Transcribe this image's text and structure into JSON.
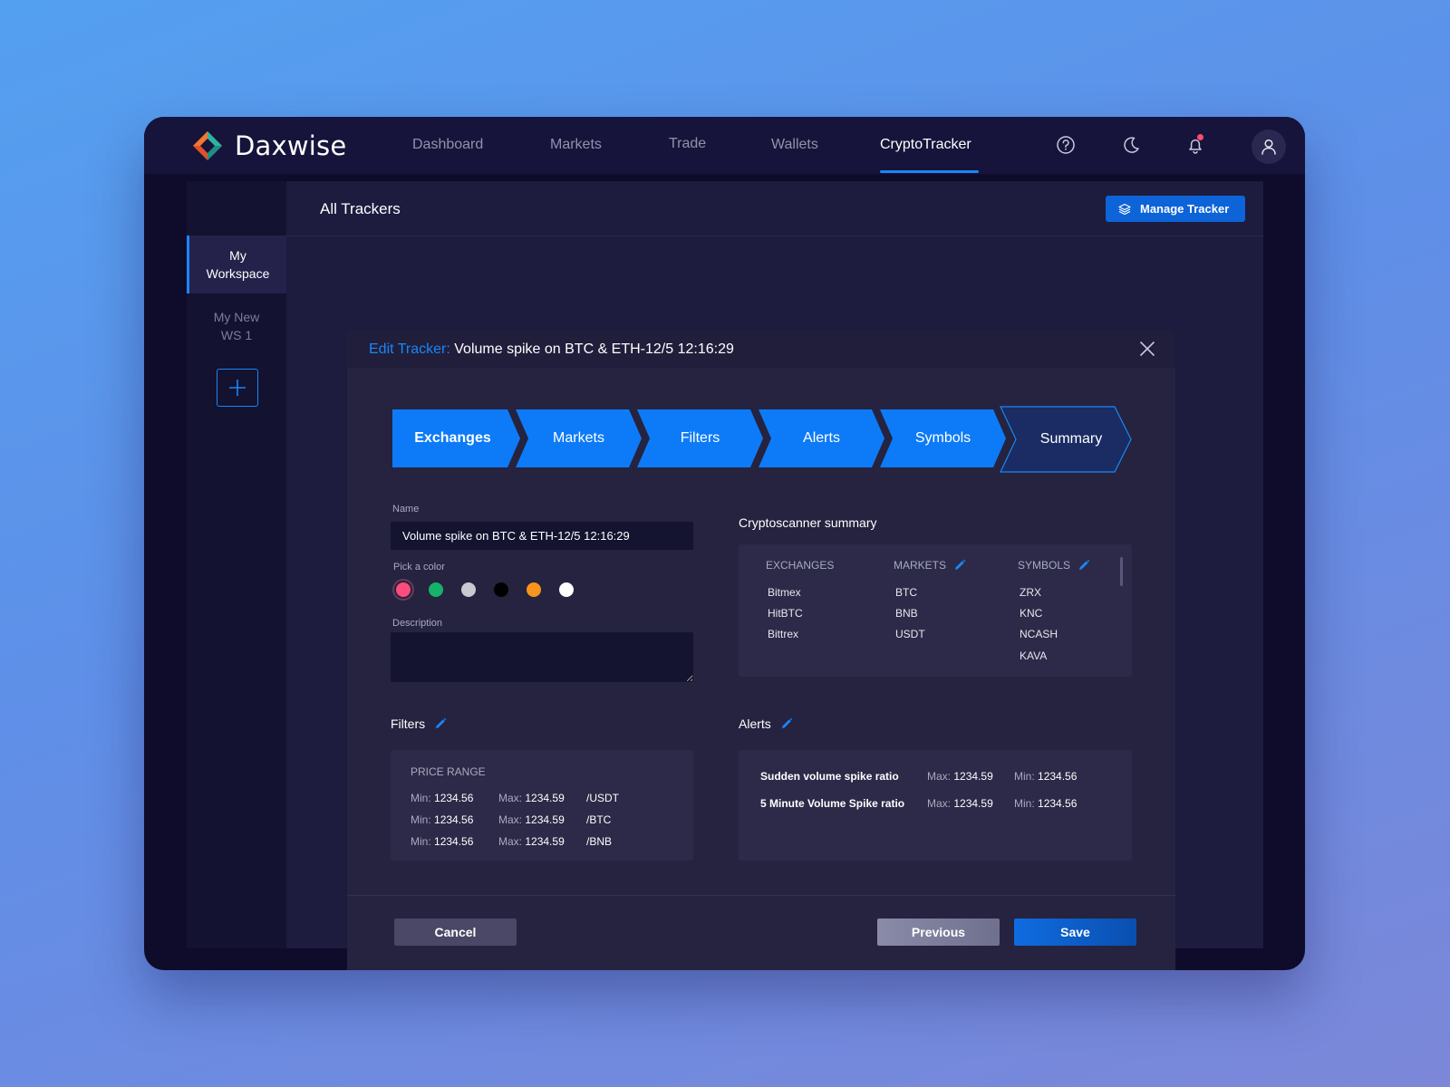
{
  "brand": {
    "name": "Daxwise"
  },
  "nav": {
    "items": [
      {
        "label": "Dashboard"
      },
      {
        "label": "Markets"
      },
      {
        "label": "Trade"
      },
      {
        "label": "Wallets"
      },
      {
        "label": "CryptoTracker"
      }
    ],
    "active": "CryptoTracker"
  },
  "top_icons": [
    "help-circle-icon",
    "moon-icon",
    "bell-icon",
    "user-icon"
  ],
  "colors": {
    "accent": "#1b86f5",
    "background": "#0e0c2a",
    "panel": "#2c2a48",
    "notification": "#ff4b6e"
  },
  "sidebar": {
    "items": [
      {
        "label": "My Workspace"
      },
      {
        "label": "My New WS 1"
      }
    ]
  },
  "page": {
    "title": "All Trackers",
    "manage_button": "Manage Tracker"
  },
  "modal": {
    "title_label": "Edit Tracker:",
    "title_value": "Volume spike on BTC & ETH-12/5 12:16:29",
    "steps": [
      {
        "label": "Exchanges"
      },
      {
        "label": "Markets"
      },
      {
        "label": "Filters"
      },
      {
        "label": "Alerts"
      },
      {
        "label": "Symbols"
      },
      {
        "label": "Summary"
      }
    ],
    "active_step": "Summary",
    "form": {
      "name_label": "Name",
      "name_value": "Volume spike on BTC & ETH-12/5 12:16:29",
      "color_label": "Pick a color",
      "colors": [
        "#ff4b7d",
        "#15b36a",
        "#c9c9cf",
        "#000000",
        "#f7941d",
        "#ffffff"
      ],
      "selected_color": "#ff4b7d",
      "description_label": "Description",
      "description_value": ""
    },
    "summary": {
      "title": "Cryptoscanner summary",
      "columns": {
        "exchanges": "EXCHANGES",
        "markets": "MARKETS",
        "symbols": "SYMBOLS"
      },
      "exchanges": [
        "Bitmex",
        "HitBTC",
        "Bittrex"
      ],
      "markets": [
        "BTC",
        "BNB",
        "USDT"
      ],
      "symbols": [
        "ZRX",
        "KNC",
        "NCASH",
        "KAVA"
      ]
    },
    "filters": {
      "title": "Filters",
      "group_label": "PRICE RANGE",
      "rows": [
        {
          "min_label": "Min:",
          "min": "1234.56",
          "max_label": "Max:",
          "max": "1234.59",
          "unit": "/USDT"
        },
        {
          "min_label": "Min:",
          "min": "1234.56",
          "max_label": "Max:",
          "max": "1234.59",
          "unit": "/BTC"
        },
        {
          "min_label": "Min:",
          "min": "1234.56",
          "max_label": "Max:",
          "max": "1234.59",
          "unit": "/BNB"
        }
      ]
    },
    "alerts": {
      "title": "Alerts",
      "rows": [
        {
          "name": "Sudden volume spike ratio",
          "max_label": "Max:",
          "max": "1234.59",
          "min_label": "Min:",
          "min": "1234.56"
        },
        {
          "name": "5 Minute Volume Spike ratio",
          "max_label": "Max:",
          "max": "1234.59",
          "min_label": "Min:",
          "min": "1234.56"
        }
      ]
    },
    "footer": {
      "cancel": "Cancel",
      "previous": "Previous",
      "save": "Save"
    }
  }
}
